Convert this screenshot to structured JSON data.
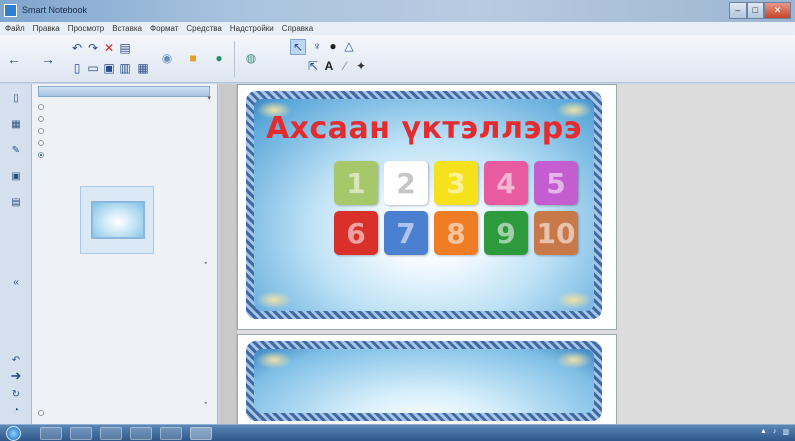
{
  "window": {
    "title": "Smart Notebook",
    "controls": [
      "–",
      "□",
      "✕"
    ]
  },
  "menu": [
    "Файл",
    "Правка",
    "Просмотр",
    "Вставка",
    "Формат",
    "Средства",
    "Надстройки",
    "Справка"
  ],
  "toolbar": {
    "icons": [
      "back-arrow-icon",
      "forward-arrow-icon",
      "undo-icon",
      "redo-icon",
      "delete-icon",
      "screen-shade-icon",
      "new-page-icon",
      "open-icon",
      "save-icon",
      "paste-icon",
      "table-icon",
      "document-camera-icon",
      "gallery-icon",
      "capture-icon",
      "select-icon",
      "pen-icon",
      "eraser-icon",
      "text-icon",
      "line-icon",
      "fill-icon",
      "shapes-icon"
    ]
  },
  "side_panel": {
    "options": [
      {
        "label": "",
        "selected": false
      },
      {
        "label": "",
        "selected": false
      },
      {
        "label": "",
        "selected": false
      },
      {
        "label": "",
        "selected": false
      },
      {
        "label": "",
        "selected": true
      }
    ],
    "bottom_option": ""
  },
  "slide": {
    "title": "Ахсаан үктэллэрэ",
    "tiles": [
      {
        "num": "1",
        "color": "#a7c86a"
      },
      {
        "num": "2",
        "color": "#ffffff"
      },
      {
        "num": "3",
        "color": "#f6e21c"
      },
      {
        "num": "4",
        "color": "#e85ba0"
      },
      {
        "num": "5",
        "color": "#c45dd0"
      },
      {
        "num": "6",
        "color": "#d9312a"
      },
      {
        "num": "7",
        "color": "#4b7fd0"
      },
      {
        "num": "8",
        "color": "#ef7d26"
      },
      {
        "num": "9",
        "color": "#2e9a3e"
      },
      {
        "num": "10",
        "color": "#c9784a"
      }
    ]
  },
  "taskbar": {
    "apps": [
      "explorer",
      "media",
      "firefox",
      "paint",
      "notebook",
      "powerpoint"
    ]
  }
}
